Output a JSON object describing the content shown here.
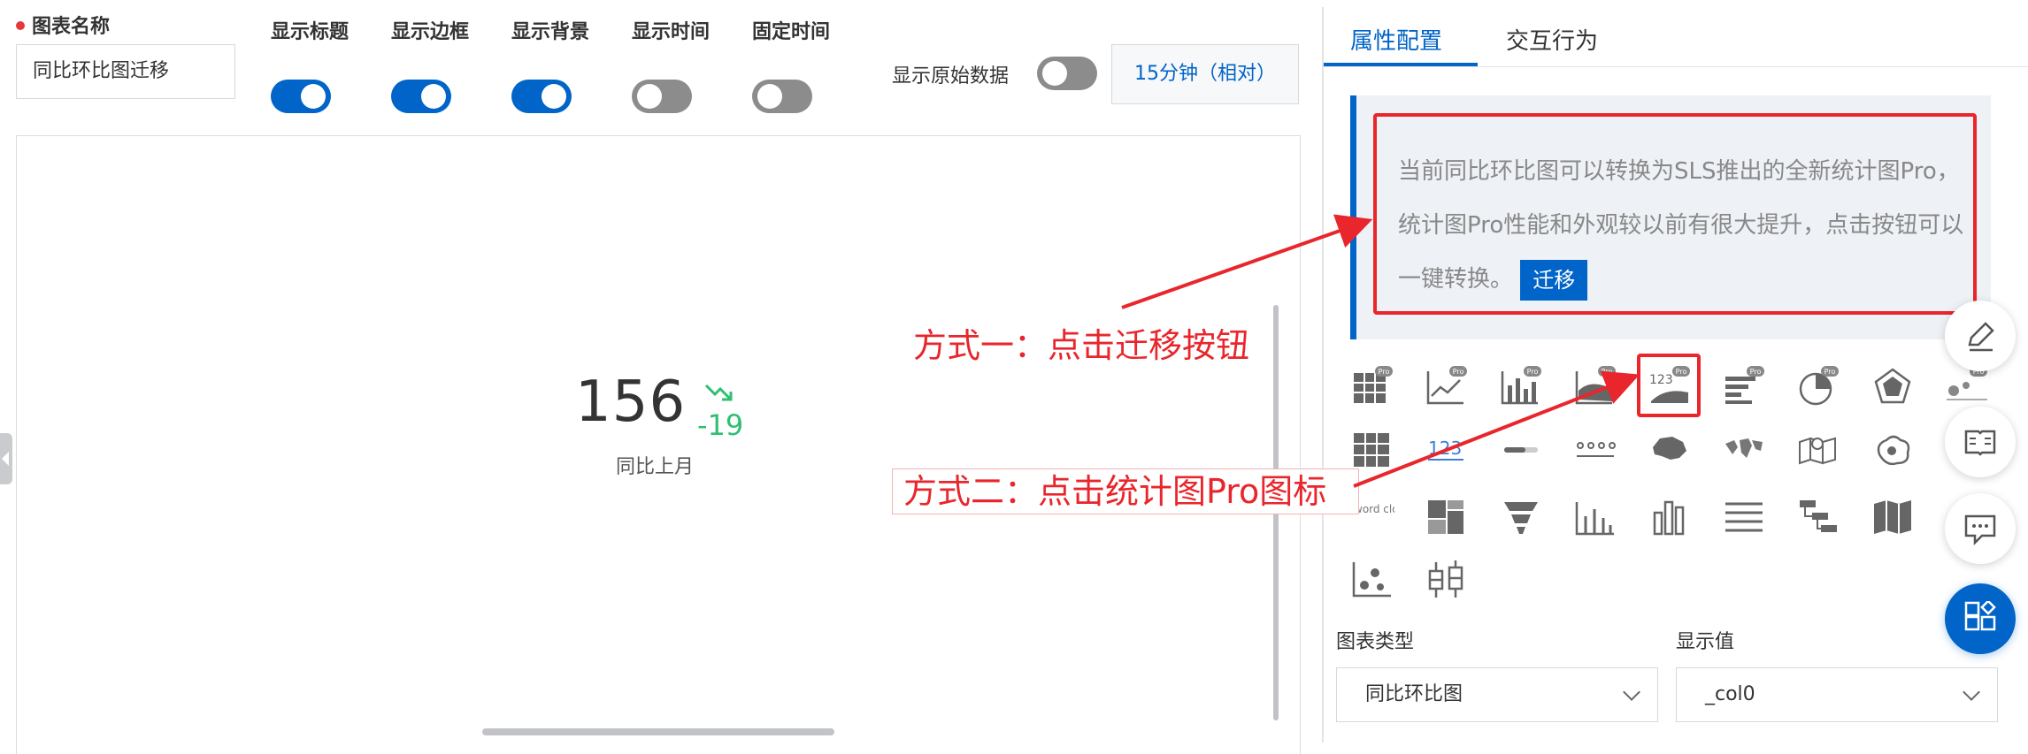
{
  "config": {
    "name_label": "图表名称",
    "name_value": "同比环比图迁移",
    "toggles": [
      {
        "label": "显示标题",
        "on": true
      },
      {
        "label": "显示边框",
        "on": true
      },
      {
        "label": "显示背景",
        "on": true
      },
      {
        "label": "显示时间",
        "on": false
      },
      {
        "label": "固定时间",
        "on": false
      }
    ],
    "raw_data_label": "显示原始数据",
    "raw_data_on": false,
    "time_range": "15分钟（相对）"
  },
  "chart": {
    "value": "156",
    "diff": "-19",
    "compare_label": "同比上月",
    "trend": "down",
    "diff_color": "#2fbf71"
  },
  "right_panel": {
    "tabs": [
      "属性配置",
      "交互行为"
    ],
    "active_tab": "属性配置",
    "notice_text": "当前同比环比图可以转换为SLS推出的全新统计图Pro，统计图Pro性能和外观较以前有很大提升，点击按钮可以一键转换。",
    "migrate_button": "迁移",
    "chart_type_label": "图表类型",
    "chart_type_value": "同比环比图",
    "display_value_label": "显示值",
    "display_value_value": "_col0",
    "pro_badge": "Pro",
    "number_icon_text": "123",
    "wordcloud_text": "word cloud",
    "chart_icons": [
      "table-pro-icon",
      "line-pro-icon",
      "bar-pro-icon",
      "area-pro-icon",
      "stat-pro-icon",
      "hbar-pro-icon",
      "pie-pro-icon",
      "radar-pro-icon",
      "scatter-pro-icon",
      "table-icon",
      "number-icon",
      "progress-icon",
      "flow-icon",
      "china-map-icon",
      "world-map-icon",
      "geo-map-icon",
      "map-shape-icon",
      "wordcloud-icon",
      "treemap-icon",
      "funnel-icon",
      "histogram-icon",
      "column-icon",
      "list-icon",
      "tree-icon",
      "bookmap-icon",
      "scatter-icon",
      "boxplot-icon"
    ]
  },
  "annotations": {
    "method1": "方式一：点击迁移按钮",
    "method2": "方式二：点击统计图Pro图标",
    "color": "#e8262c"
  },
  "colors": {
    "accent": "#0064c8",
    "toggle_off": "#8c8c8c"
  }
}
